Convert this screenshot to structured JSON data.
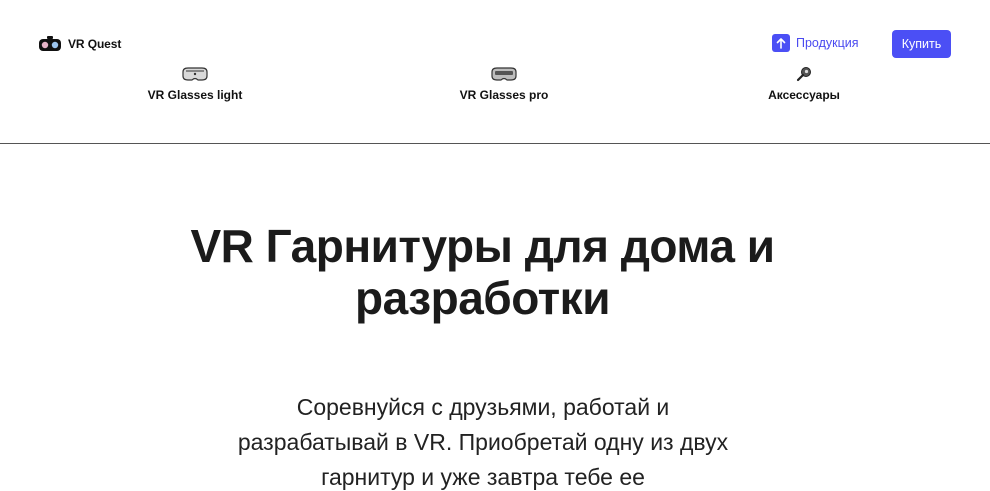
{
  "header": {
    "logo_text": "VR Quest",
    "products_label": "Продукция",
    "buy_label": "Купить",
    "accent_color": "#4b4ff5"
  },
  "nav": {
    "items": [
      {
        "label": "VR Glasses light",
        "icon": "vr-headset-light-icon"
      },
      {
        "label": "VR Glasses pro",
        "icon": "vr-headset-pro-icon"
      },
      {
        "label": "Аксессуары",
        "icon": "accessory-icon"
      }
    ]
  },
  "hero": {
    "title": "VR Гарнитуры для дома и разработки",
    "text": "Соревнуйся с друзьями, работай и разрабатывай в VR. Приобретай одну из двух гарнитур и уже завтра тебе ее"
  }
}
